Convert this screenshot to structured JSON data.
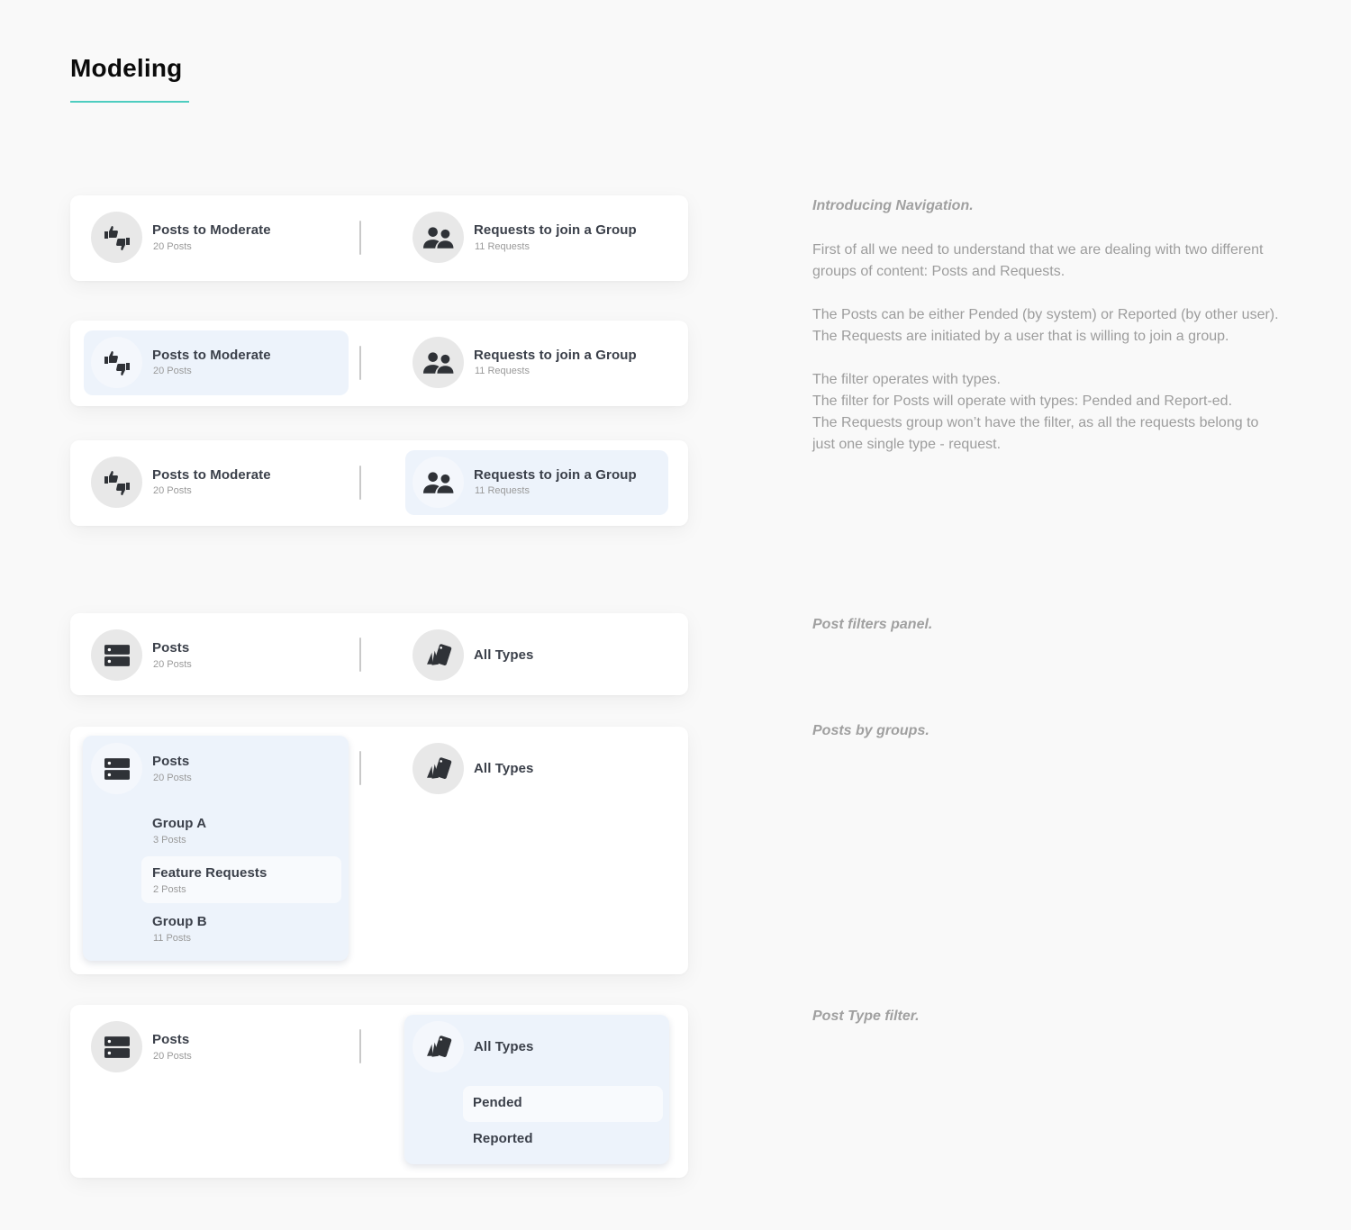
{
  "page": {
    "title": "Modeling",
    "accent_color": "#4ecdc0"
  },
  "nav_default": {
    "posts": {
      "title": "Posts to Moderate",
      "sub": "20 Posts",
      "icon": "thumbs-up-down-icon"
    },
    "requests": {
      "title": "Requests to join a Group",
      "sub": "11 Requests",
      "icon": "users-icon"
    }
  },
  "nav_posts_active": {
    "posts": {
      "title": "Posts to Moderate",
      "sub": "20 Posts",
      "icon": "thumbs-up-down-icon"
    },
    "requests": {
      "title": "Requests to join a Group",
      "sub": "11 Requests",
      "icon": "users-icon"
    }
  },
  "nav_requests_active": {
    "posts": {
      "title": "Posts to Moderate",
      "sub": "20 Posts",
      "icon": "thumbs-up-down-icon"
    },
    "requests": {
      "title": "Requests to join a Group",
      "sub": "11 Requests",
      "icon": "users-icon"
    }
  },
  "filters_panel": {
    "posts": {
      "title": "Posts",
      "sub": "20 Posts",
      "icon": "server-icon"
    },
    "types": {
      "title": "All Types",
      "icon": "swatches-icon"
    }
  },
  "posts_by_groups": {
    "posts": {
      "title": "Posts",
      "sub": "20 Posts"
    },
    "types": {
      "title": "All Types"
    },
    "groups": [
      {
        "name": "Group A",
        "count": "3 Posts"
      },
      {
        "name": "Feature Requests",
        "count": "2 Posts"
      },
      {
        "name": "Group B",
        "count": "11 Posts"
      }
    ]
  },
  "post_type_filter": {
    "posts": {
      "title": "Posts",
      "sub": "20 Posts"
    },
    "types": {
      "title": "All Types"
    },
    "options": [
      "Pended",
      "Reported"
    ]
  },
  "notes": {
    "intro_heading": "Introducing Navigation.",
    "paragraphs": [
      "First of all we need to understand that we are dealing with two different groups of content: Posts and Requests.",
      "The Posts can be either Pended (by system) or Reported (by other user).",
      "The Requests are initiated by a user that is willing to join a group.",
      "The filter operates with types.",
      "The filter for Posts will operate with types: Pended and Report-ed.",
      "The Requests group won’t have the filter, as all the requests belong to just one single type - request."
    ],
    "filters_heading": "Post filters panel.",
    "groups_heading": "Posts by groups.",
    "type_filter_heading": "Post Type filter."
  }
}
